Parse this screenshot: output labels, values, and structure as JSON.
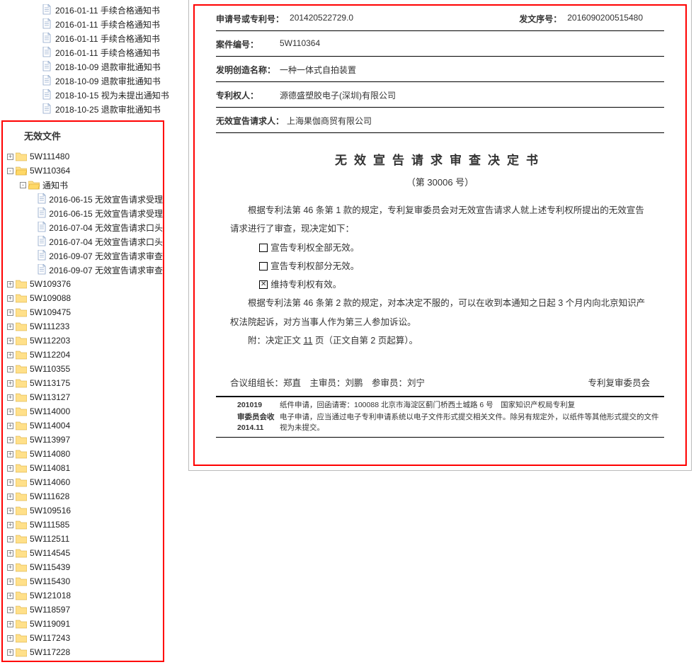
{
  "tree_top": [
    {
      "type": "file",
      "label": "2016-01-11 手续合格通知书"
    },
    {
      "type": "file",
      "label": "2016-01-11 手续合格通知书"
    },
    {
      "type": "file",
      "label": "2016-01-11 手续合格通知书"
    },
    {
      "type": "file",
      "label": "2016-01-11 手续合格通知书"
    },
    {
      "type": "file",
      "label": "2018-10-09 退款审批通知书"
    },
    {
      "type": "file",
      "label": "2018-10-09 退款审批通知书"
    },
    {
      "type": "file",
      "label": "2018-10-15 视为未提出通知书"
    },
    {
      "type": "file",
      "label": "2018-10-25 退款审批通知书"
    }
  ],
  "section2_title": "无效文件",
  "tree2": [
    {
      "level": 0,
      "type": "folder",
      "toggle": "+",
      "label": "5W111480"
    },
    {
      "level": 0,
      "type": "folder",
      "toggle": "-",
      "label": "5W110364"
    },
    {
      "level": 1,
      "type": "folder",
      "toggle": "-",
      "label": "通知书"
    },
    {
      "level": 2,
      "type": "file",
      "label": "2016-06-15 无效宣告请求受理"
    },
    {
      "level": 2,
      "type": "file",
      "label": "2016-06-15 无效宣告请求受理"
    },
    {
      "level": 2,
      "type": "file",
      "label": "2016-07-04 无效宣告请求口头"
    },
    {
      "level": 2,
      "type": "file",
      "label": "2016-07-04 无效宣告请求口头"
    },
    {
      "level": 2,
      "type": "file",
      "label": "2016-09-07 无效宣告请求审查"
    },
    {
      "level": 2,
      "type": "file",
      "label": "2016-09-07 无效宣告请求审查"
    },
    {
      "level": 0,
      "type": "folder",
      "toggle": "+",
      "label": "5W109376"
    },
    {
      "level": 0,
      "type": "folder",
      "toggle": "+",
      "label": "5W109088"
    },
    {
      "level": 0,
      "type": "folder",
      "toggle": "+",
      "label": "5W109475"
    },
    {
      "level": 0,
      "type": "folder",
      "toggle": "+",
      "label": "5W111233"
    },
    {
      "level": 0,
      "type": "folder",
      "toggle": "+",
      "label": "5W112203"
    },
    {
      "level": 0,
      "type": "folder",
      "toggle": "+",
      "label": "5W112204"
    },
    {
      "level": 0,
      "type": "folder",
      "toggle": "+",
      "label": "5W110355"
    },
    {
      "level": 0,
      "type": "folder",
      "toggle": "+",
      "label": "5W113175"
    },
    {
      "level": 0,
      "type": "folder",
      "toggle": "+",
      "label": "5W113127"
    },
    {
      "level": 0,
      "type": "folder",
      "toggle": "+",
      "label": "5W114000"
    },
    {
      "level": 0,
      "type": "folder",
      "toggle": "+",
      "label": "5W114004"
    },
    {
      "level": 0,
      "type": "folder",
      "toggle": "+",
      "label": "5W113997"
    },
    {
      "level": 0,
      "type": "folder",
      "toggle": "+",
      "label": "5W114080"
    },
    {
      "level": 0,
      "type": "folder",
      "toggle": "+",
      "label": "5W114081"
    },
    {
      "level": 0,
      "type": "folder",
      "toggle": "+",
      "label": "5W114060"
    },
    {
      "level": 0,
      "type": "folder",
      "toggle": "+",
      "label": "5W111628"
    },
    {
      "level": 0,
      "type": "folder",
      "toggle": "+",
      "label": "5W109516"
    },
    {
      "level": 0,
      "type": "folder",
      "toggle": "+",
      "label": "5W111585"
    },
    {
      "level": 0,
      "type": "folder",
      "toggle": "+",
      "label": "5W112511"
    },
    {
      "level": 0,
      "type": "folder",
      "toggle": "+",
      "label": "5W114545"
    },
    {
      "level": 0,
      "type": "folder",
      "toggle": "+",
      "label": "5W115439"
    },
    {
      "level": 0,
      "type": "folder",
      "toggle": "+",
      "label": "5W115430"
    },
    {
      "level": 0,
      "type": "folder",
      "toggle": "+",
      "label": "5W121018"
    },
    {
      "level": 0,
      "type": "folder",
      "toggle": "+",
      "label": "5W118597"
    },
    {
      "level": 0,
      "type": "folder",
      "toggle": "+",
      "label": "5W119091"
    },
    {
      "level": 0,
      "type": "folder",
      "toggle": "+",
      "label": "5W117243"
    },
    {
      "level": 0,
      "type": "folder",
      "toggle": "+",
      "label": "5W117228"
    }
  ],
  "doc": {
    "meta": {
      "app_no_label": "申请号或专利号：",
      "app_no": "201420522729.0",
      "issue_no_label": "发文序号：",
      "issue_no": "2016090200515480",
      "case_label": "案件编号：",
      "case": "5W110364",
      "name_label": "发明创造名称：",
      "name": "一种一体式自拍装置",
      "holder_label": "专利权人：",
      "holder": "源德盛塑胶电子(深圳)有限公司",
      "requester_label": "无效宣告请求人：",
      "requester": "上海果伽商贸有限公司"
    },
    "title": "无效宣告请求审查决定书",
    "sub": "（第 30006 号）",
    "p1": "根据专利法第 46 条第 1 款的规定，专利复审委员会对无效宣告请求人就上述专利权所提出的无效宣告请求进行了审查，现决定如下：",
    "opt1": "宣告专利权全部无效。",
    "opt2": "宣告专利权部分无效。",
    "opt3": "维持专利权有效。",
    "p2": "根据专利法第 46 条第 2 款的规定，对本决定不服的，可以在收到本通知之日起 3 个月内向北京知识产权法院起诉，对方当事人作为第三人参加诉讼。",
    "p3a": "附：决定正文 ",
    "p3_pages": "11",
    "p3b": " 页（正文自第 2 页起算）。",
    "foot_left": "合议组组长：郑直　主审员：刘鹏　参审员：刘宁",
    "foot_right": "专利复审委员会",
    "note_left1": "201019",
    "note_left2": "审委员会收",
    "note_left3": "2014.11",
    "note_r1": "纸件申请，回函请寄：100088 北京市海淀区蓟门桥西土城路 6 号　国家知识产权局专利复",
    "note_r2": "电子申请，应当通过电子专利申请系统以电子文件形式提交相关文件。除另有规定外，以纸件等其他形式提交的文件视为未提交。"
  }
}
